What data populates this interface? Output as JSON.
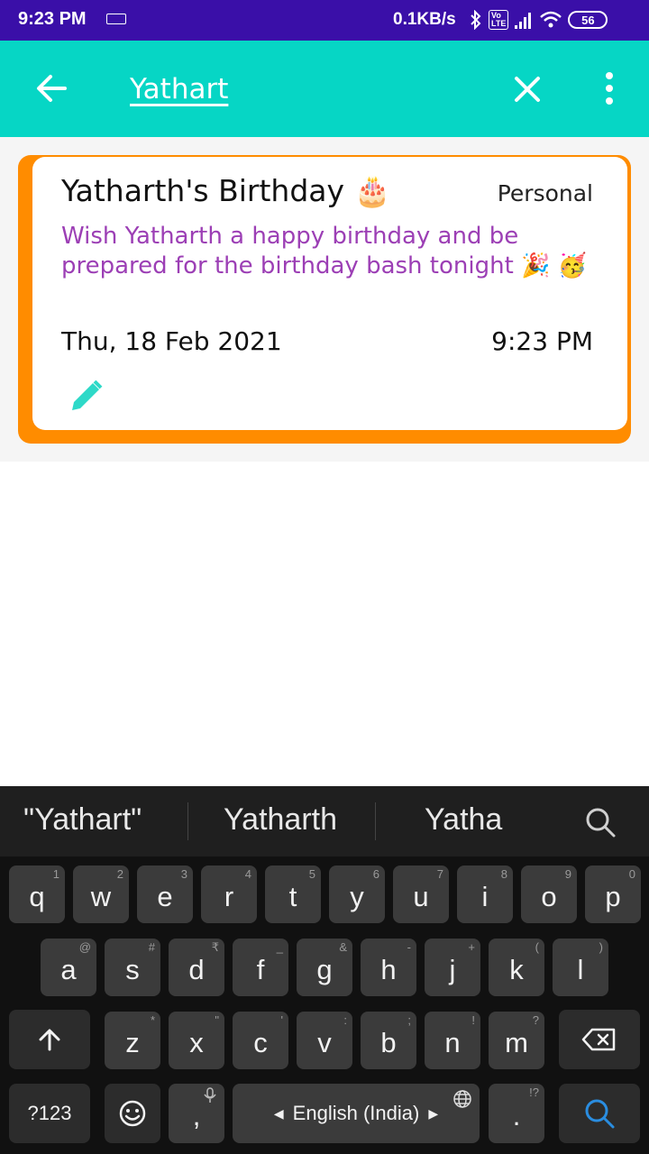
{
  "status_bar": {
    "time": "9:23 PM",
    "network_speed": "0.1KB/s",
    "volte": "Vo LTE",
    "battery": "56",
    "icons": [
      "keyboard-icon",
      "bluetooth-icon",
      "volte-icon",
      "signal-icon",
      "wifi-icon",
      "battery-icon"
    ]
  },
  "app_bar": {
    "search_query": "Yathart",
    "color": "#06d6c5",
    "icons": [
      "back-arrow-icon",
      "close-icon",
      "more-vert-icon"
    ]
  },
  "card": {
    "title": "Yatharth's Birthday",
    "title_emoji": "🎂",
    "category": "Personal",
    "description": "Wish Yatharth a happy birthday and be prepared for the birthday bash tonight 🎉 🥳",
    "date": "Thu, 18 Feb 2021",
    "time": "9:23 PM",
    "border_color": "#ff8c00",
    "description_color": "#9c3fb5",
    "edit_icon": "pencil-icon"
  },
  "keyboard": {
    "suggestions": [
      "\"Yathart\"",
      "Yatharth",
      "Yatha"
    ],
    "row1": [
      {
        "key": "q",
        "hint": "1"
      },
      {
        "key": "w",
        "hint": "2"
      },
      {
        "key": "e",
        "hint": "3"
      },
      {
        "key": "r",
        "hint": "4"
      },
      {
        "key": "t",
        "hint": "5"
      },
      {
        "key": "y",
        "hint": "6"
      },
      {
        "key": "u",
        "hint": "7"
      },
      {
        "key": "i",
        "hint": "8"
      },
      {
        "key": "o",
        "hint": "9"
      },
      {
        "key": "p",
        "hint": "0"
      }
    ],
    "row2": [
      {
        "key": "a",
        "hint": "@"
      },
      {
        "key": "s",
        "hint": "#"
      },
      {
        "key": "d",
        "hint": "₹"
      },
      {
        "key": "f",
        "hint": "_"
      },
      {
        "key": "g",
        "hint": "&"
      },
      {
        "key": "h",
        "hint": "-"
      },
      {
        "key": "j",
        "hint": "+"
      },
      {
        "key": "k",
        "hint": "("
      },
      {
        "key": "l",
        "hint": ")"
      }
    ],
    "row3": [
      {
        "key": "z",
        "hint": "*"
      },
      {
        "key": "x",
        "hint": "\""
      },
      {
        "key": "c",
        "hint": "'"
      },
      {
        "key": "v",
        "hint": ":"
      },
      {
        "key": "b",
        "hint": ";"
      },
      {
        "key": "n",
        "hint": "!"
      },
      {
        "key": "m",
        "hint": "?"
      }
    ],
    "symbols_key": "?123",
    "comma_key": ",",
    "space_label": "English (India)",
    "period_key": ".",
    "period_hint": "!?"
  }
}
